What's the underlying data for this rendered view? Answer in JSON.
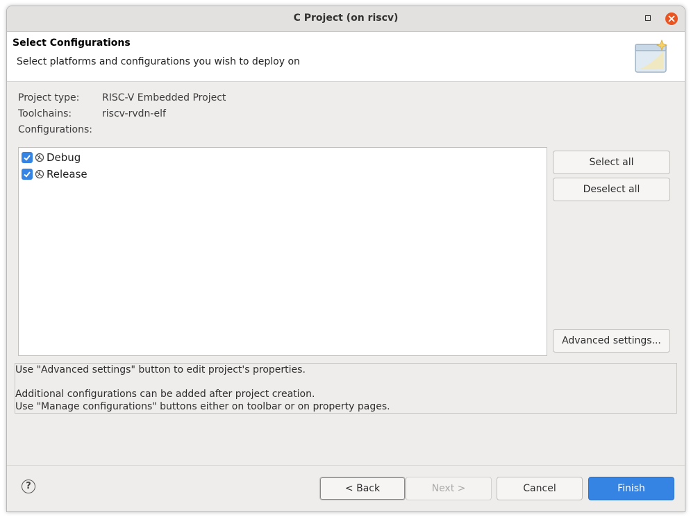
{
  "window": {
    "title": "C Project  (on riscv)",
    "accent_color": "#3584e4",
    "close_color": "#e95420"
  },
  "header": {
    "title": "Select Configurations",
    "description": "Select platforms and configurations you wish to deploy on",
    "banner_icon": "wizard-banner-icon"
  },
  "project": {
    "type_label": "Project type:",
    "type_value": "RISC-V Embedded Project",
    "toolchains_label": "Toolchains:",
    "toolchains_value": "riscv-rvdn-elf",
    "configurations_label": "Configurations:"
  },
  "configurations": [
    {
      "label": "Debug",
      "checked": true,
      "icon": "build-config-icon"
    },
    {
      "label": "Release",
      "checked": true,
      "icon": "build-config-icon"
    }
  ],
  "side_buttons": {
    "select_all": "Select all",
    "deselect_all": "Deselect all",
    "advanced": "Advanced settings..."
  },
  "info": {
    "line1": "Use \"Advanced settings\" button to edit project's properties.",
    "line2": "Additional configurations can be added after project creation.",
    "line3": "Use \"Manage configurations\" buttons either on toolbar or on property pages."
  },
  "footer": {
    "help_icon": "help-icon",
    "back": "< Back",
    "next": "Next >",
    "cancel": "Cancel",
    "finish": "Finish"
  }
}
